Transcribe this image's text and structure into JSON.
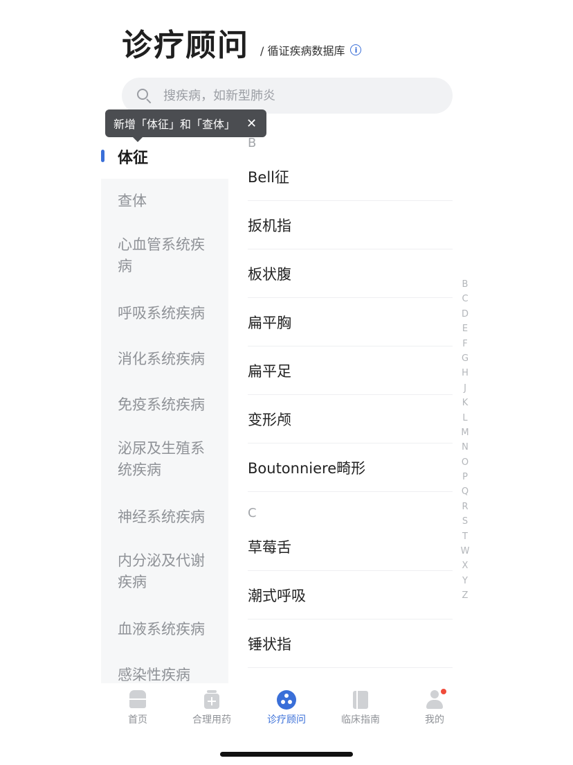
{
  "header": {
    "title": "诊疗顾问",
    "subtitle": "/ 循证疾病数据库",
    "info_icon": "info-icon"
  },
  "search": {
    "placeholder": "搜疾病，如新型肺炎",
    "icon": "search-icon"
  },
  "tooltip": {
    "text": "新增「体征」和「查体」",
    "close": "✕"
  },
  "sidebar": {
    "active": "体征",
    "accent_color": "#3a6fd8",
    "items": [
      {
        "label": "查体",
        "lines": 1
      },
      {
        "label": "心血管系统疾病",
        "lines": 2
      },
      {
        "label": "呼吸系统疾病",
        "lines": 1
      },
      {
        "label": "消化系统疾病",
        "lines": 1
      },
      {
        "label": "免疫系统疾病",
        "lines": 1
      },
      {
        "label": "泌尿及生殖系统疾病",
        "lines": 2
      },
      {
        "label": "神经系统疾病",
        "lines": 1
      },
      {
        "label": "内分泌及代谢疾病",
        "lines": 2
      },
      {
        "label": "血液系统疾病",
        "lines": 1
      },
      {
        "label": "感染性疾病",
        "lines": 1
      }
    ]
  },
  "list": {
    "groups": [
      {
        "letter": "B",
        "items": [
          "Bell征",
          "扳机指",
          "板状腹",
          "扁平胸",
          "扁平足",
          "变形颅",
          "Boutonniere畸形"
        ]
      },
      {
        "letter": "C",
        "items": [
          "草莓舌",
          "潮式呼吸",
          "锤状指"
        ]
      }
    ]
  },
  "index_letters": [
    "B",
    "C",
    "D",
    "E",
    "F",
    "G",
    "H",
    "J",
    "K",
    "L",
    "M",
    "N",
    "O",
    "P",
    "Q",
    "R",
    "S",
    "T",
    "W",
    "X",
    "Y",
    "Z"
  ],
  "tabbar": {
    "tabs": [
      {
        "label": "首页",
        "icon": "home-icon"
      },
      {
        "label": "合理用药",
        "icon": "medicine-icon"
      },
      {
        "label": "诊疗顾问",
        "icon": "diagnosis-icon",
        "active": true
      },
      {
        "label": "临床指南",
        "icon": "guide-book-icon"
      },
      {
        "label": "我的",
        "icon": "profile-icon"
      }
    ]
  }
}
